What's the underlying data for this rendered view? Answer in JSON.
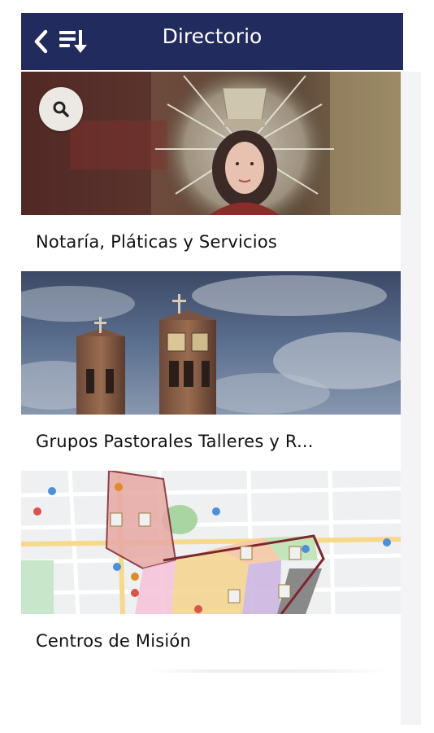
{
  "header": {
    "title": "Directorio",
    "color": "#222b5e"
  },
  "icons": {
    "back": "chevron-left-icon",
    "sort": "sort-list-icon",
    "search": "search-icon"
  },
  "cards": [
    {
      "label": "Notaría, Pláticas y Servicios"
    },
    {
      "label": "Grupos Pastorales Talleres y R..."
    },
    {
      "label": "Centros de Misión"
    }
  ]
}
